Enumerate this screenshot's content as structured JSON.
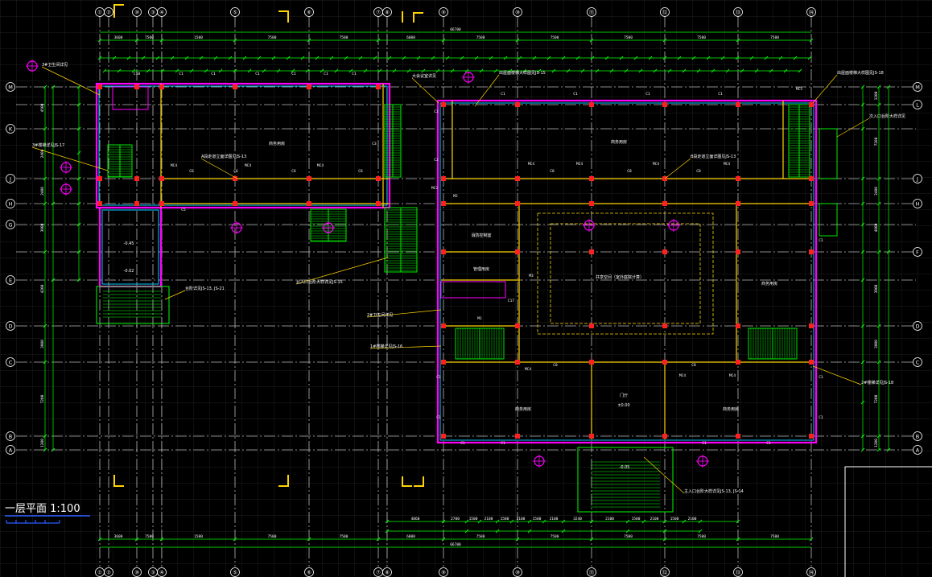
{
  "drawing": {
    "title": "一层平面 1:100",
    "overall_dimension": "66700",
    "colors": {
      "background": "#000000",
      "grid": "#2a2a2a",
      "axis_line": "#b8b8b8",
      "wall_outer": "#ff00ff",
      "wall_inner": "#00c8ff",
      "partition": "#ffd400",
      "dimension": "#00ff00",
      "stairs": "#00ff00",
      "column": "#ff2020",
      "text": "#ffffff",
      "leader": "#ffd400",
      "title_underline": "#2a5cff"
    }
  },
  "axes": {
    "columns": [
      {
        "label": "①"
      },
      {
        "label": "②"
      },
      {
        "label": "⑩"
      },
      {
        "label": "③"
      },
      {
        "label": "④"
      },
      {
        "label": "⑤"
      },
      {
        "label": "⑥"
      },
      {
        "label": "⑦"
      },
      {
        "label": "⑧"
      },
      {
        "label": "⑨"
      },
      {
        "label": "⑩"
      },
      {
        "label": "⑪"
      },
      {
        "label": "⑫"
      },
      {
        "label": "⑬"
      },
      {
        "label": "⑭"
      }
    ],
    "rows": [
      {
        "label": "M"
      },
      {
        "label": "L"
      },
      {
        "label": "K"
      },
      {
        "label": "J"
      },
      {
        "label": "H"
      },
      {
        "label": "G"
      },
      {
        "label": "F"
      },
      {
        "label": "E"
      },
      {
        "label": "D"
      },
      {
        "label": "C"
      },
      {
        "label": "B"
      },
      {
        "label": "A"
      }
    ]
  },
  "dimensions": {
    "top_segments": [
      "3600",
      "7500",
      "1500",
      "7500",
      "7500",
      "6000",
      "7500",
      "7500",
      "7500",
      "7500",
      "7500"
    ],
    "bottom_segments": [
      "4860",
      "2700",
      "1500",
      "2100",
      "1500",
      "2100",
      "1500",
      "2100",
      "3240",
      "2100",
      "1500",
      "2100",
      "1500",
      "2100"
    ],
    "left_segments": [
      "4500",
      "2400",
      "2400",
      "3900",
      "4200",
      "3900",
      "7200",
      "1200"
    ],
    "right_segments": [
      "1200",
      "7200",
      "2400",
      "4800",
      "3900",
      "3900",
      "7200",
      "1200"
    ]
  },
  "rooms": [
    {
      "label": "商务用房"
    },
    {
      "label": "商务用房"
    },
    {
      "label": "消防控制室"
    },
    {
      "label": "管理用房"
    },
    {
      "label": "共享空间（室外庭院计算）"
    },
    {
      "label": "商务用房"
    },
    {
      "label": "门厅"
    },
    {
      "label": "商务用房"
    },
    {
      "label": "商务用房"
    }
  ],
  "annotations": [
    {
      "text": "3#卫生间详见"
    },
    {
      "text": "3#楼梯详见JS-17"
    },
    {
      "text": "大会议室详见"
    },
    {
      "text": "出屋面楼梯大样图见JS-15"
    },
    {
      "text": "A段走道立面详图见JS-13"
    },
    {
      "text": "B段走道立面详图见JS-13"
    },
    {
      "text": "出屋面楼梯大样图见JS-18"
    },
    {
      "text": "次入口台阶大样详见"
    },
    {
      "text": "北入口台阶大样详见JS-15"
    },
    {
      "text": "2#卫生间详见"
    },
    {
      "text": "1#楼梯详见JS-16"
    },
    {
      "text": "2#楼梯详见JS-18"
    },
    {
      "text": "台阶详见JS-13, JS-21"
    },
    {
      "text": "主入口台阶大样详见JS-13, JS-14"
    }
  ],
  "elevations": [
    "±0.00",
    "-0.05",
    "-0.45",
    "-0.02"
  ],
  "window_tags": [
    "C1",
    "C2",
    "C3",
    "C5",
    "C6",
    "C8",
    "C10",
    "C17",
    "MC2",
    "MC4",
    "MC5",
    "M1",
    "M2",
    "M3"
  ]
}
